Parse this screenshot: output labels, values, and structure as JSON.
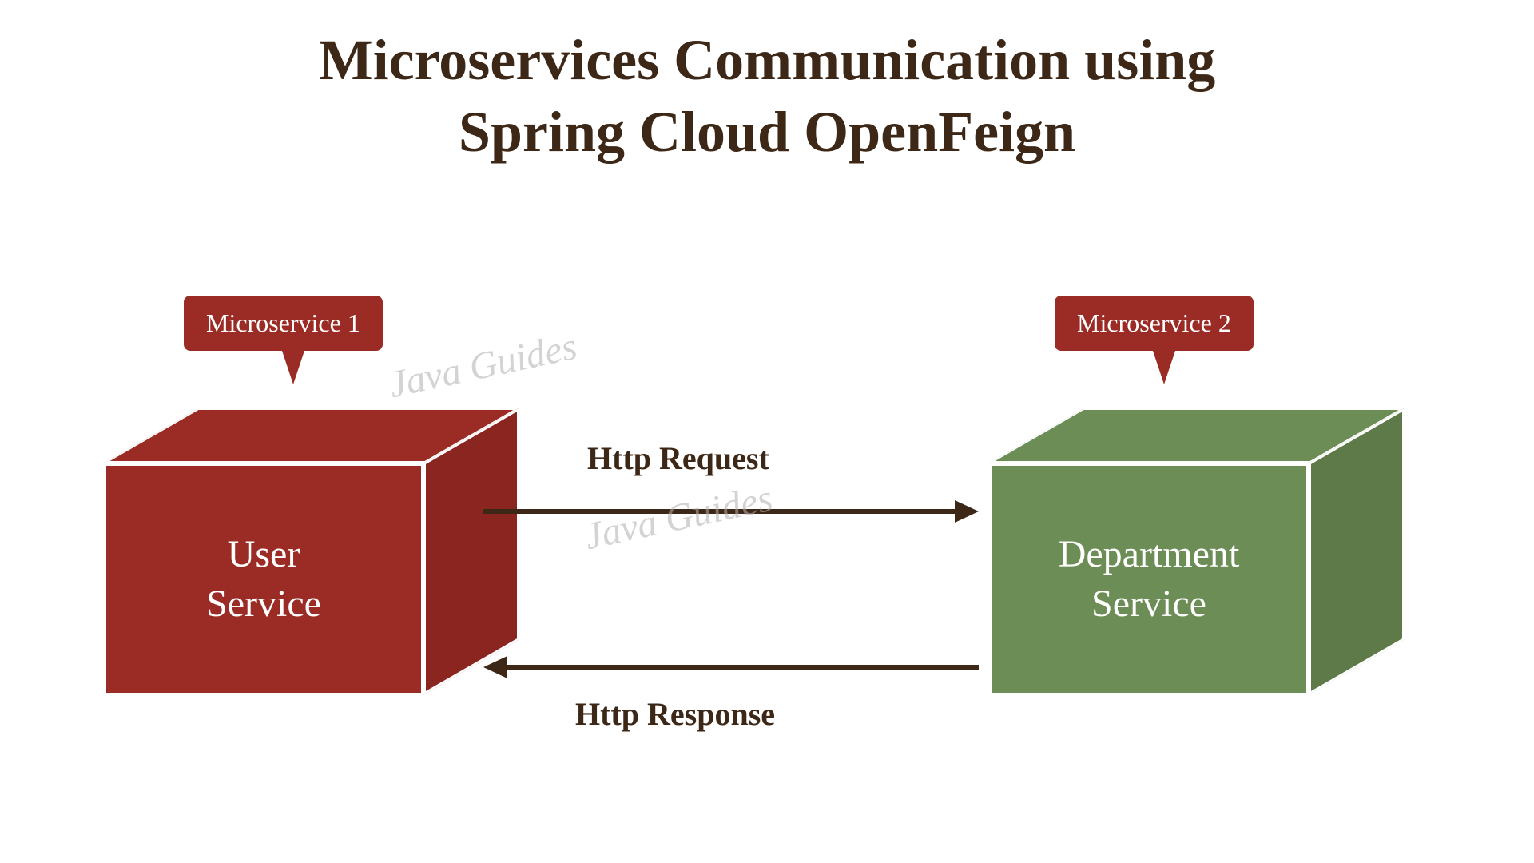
{
  "title_line1": "Microservices Communication using",
  "title_line2": "Spring Cloud OpenFeign",
  "callouts": {
    "ms1": "Microservice 1",
    "ms2": "Microservice 2"
  },
  "services": {
    "user_line1": "User",
    "user_line2": "Service",
    "dept_line1": "Department",
    "dept_line2": "Service"
  },
  "arrows": {
    "request": "Http Request",
    "response": "Http Response"
  },
  "watermark": "Java Guides",
  "colors": {
    "title": "#3d2817",
    "red_box": "#9b2c25",
    "red_box_side": "#8a2520",
    "green_box": "#6c8d55",
    "green_box_side": "#5d7a48",
    "arrow": "#3d2817"
  }
}
